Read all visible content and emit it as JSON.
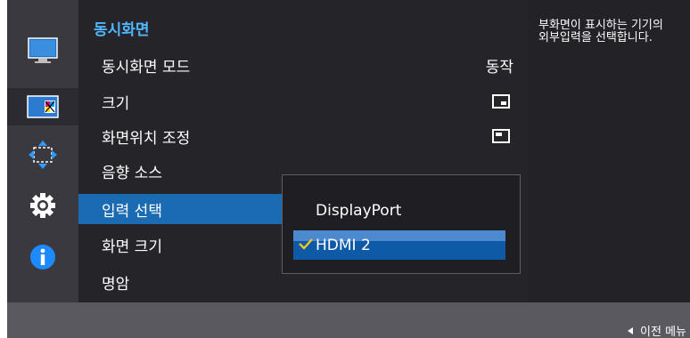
{
  "sidebar": {
    "items": [
      {
        "icon": "monitor-icon",
        "active": false
      },
      {
        "icon": "pip-icon",
        "active": true
      },
      {
        "icon": "move-arrows-icon",
        "active": false
      },
      {
        "icon": "gear-icon",
        "active": false
      },
      {
        "icon": "info-icon",
        "active": false
      }
    ]
  },
  "menu": {
    "title": "동시화면",
    "items": [
      {
        "label": "동시화면 모드",
        "value": "동작"
      },
      {
        "label": "크기",
        "value_icon": "size-corner-icon"
      },
      {
        "label": "화면위치 조정",
        "value_icon": "position-topleft-icon"
      },
      {
        "label": "음향 소스"
      },
      {
        "label": "입력 선택",
        "highlighted": true
      },
      {
        "label": "화면 크기"
      },
      {
        "label": "명암"
      }
    ]
  },
  "popup": {
    "options": [
      "DisplayPort",
      "HDMI 2"
    ],
    "selected": "HDMI 2"
  },
  "description": {
    "text": "부화면이 표시하는 기기의 외부입력을 선택합니다."
  },
  "footer": {
    "back_label": "이전 메뉴"
  },
  "colors": {
    "accent_title": "#4fb6ff",
    "highlight": "#1b6bb2",
    "check": "#f2c81a"
  }
}
